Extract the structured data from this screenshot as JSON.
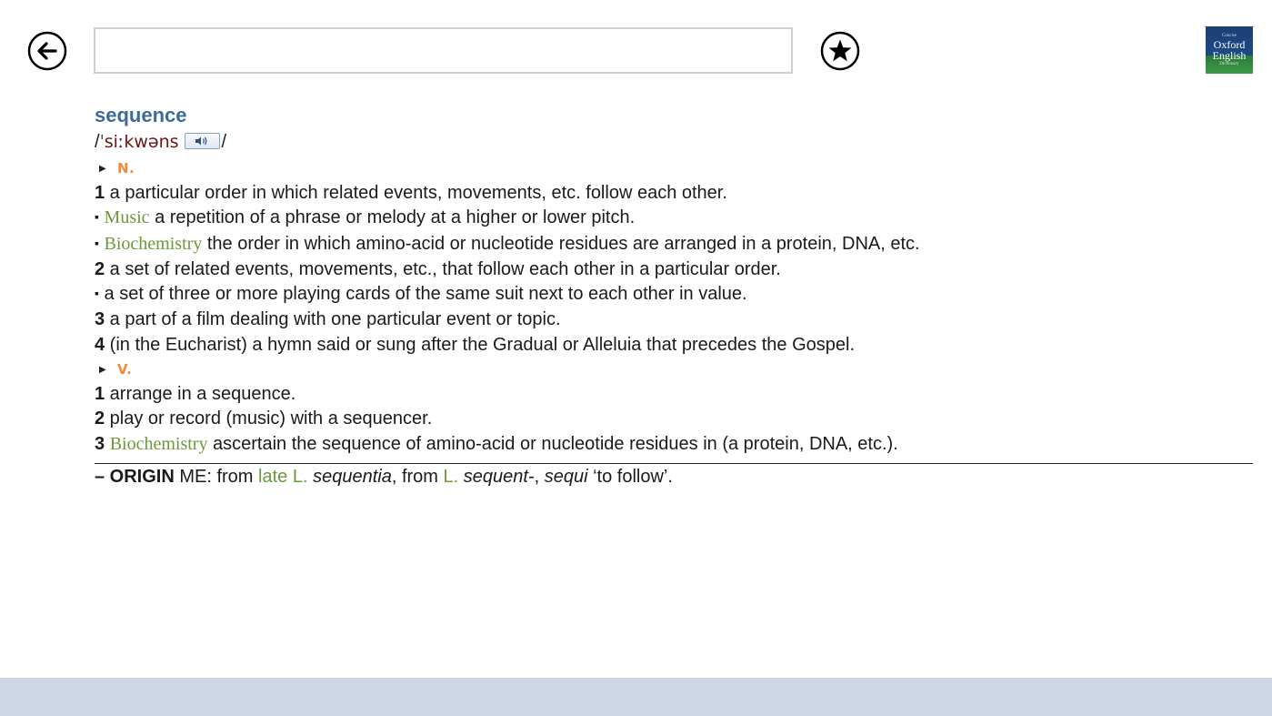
{
  "toolbar": {
    "search_value": "",
    "search_placeholder": ""
  },
  "logo": {
    "line1": "Concise",
    "line2": "Oxford",
    "line3": "English",
    "line4": "Dictionary"
  },
  "entry": {
    "headword": "sequence",
    "pron_open": "/",
    "pronunciation": "ˈsiːkwəns",
    "pron_close": "/",
    "noun_label": "N.",
    "noun_senses": [
      {
        "num": "1",
        "domain": "",
        "text": " a particular order in which related events, movements, etc. follow each other."
      },
      {
        "bullet": "▪",
        "domain": "Music",
        "text": " a repetition of a phrase or melody at a higher or lower pitch."
      },
      {
        "bullet": "▪",
        "domain": "Biochemistry",
        "text": " the order in which amino-acid or nucleotide residues are arranged in a protein, DNA, etc."
      },
      {
        "num": "2",
        "domain": "",
        "text": " a set of related events, movements, etc., that follow each other in a particular order."
      },
      {
        "bullet": "▪",
        "domain": "",
        "text": " a set of three or more playing cards of the same suit next to each other in value."
      },
      {
        "num": "3",
        "domain": "",
        "text": " a part of a film dealing with one particular event or topic."
      },
      {
        "num": "4",
        "domain": "",
        "text": " (in the Eucharist) a hymn said or sung after the Gradual or Alleluia that precedes the Gospel."
      }
    ],
    "verb_label": "V.",
    "verb_senses": [
      {
        "num": "1",
        "domain": "",
        "text": " arrange in a sequence."
      },
      {
        "num": "2",
        "domain": "",
        "text": " play or record (music) with a sequencer."
      },
      {
        "num": "3",
        "domain": "Biochemistry",
        "text": " ascertain the sequence of amino-acid or nucleotide residues in (a protein, DNA, etc.)."
      }
    ],
    "origin": {
      "label": "– ORIGIN",
      "t1": " ME: from ",
      "g1": "late L.",
      "t2": " ",
      "i1": "sequentia",
      "t3": ", from ",
      "g2": "L.",
      "t4": " ",
      "i2": "sequent-",
      "t5": ", ",
      "i3": "sequi",
      "t6": " ‘to follow’."
    }
  },
  "icons": {
    "back": "back-arrow-circle-icon",
    "favorite": "star-circle-icon",
    "audio": "speaker-icon"
  },
  "colors": {
    "headword": "#3d6a9b",
    "part_of_speech": "#ef8a3d",
    "domain_label": "#6a9a3a",
    "pronunciation": "#6a1414",
    "app_bar": "#cdd6e4"
  }
}
